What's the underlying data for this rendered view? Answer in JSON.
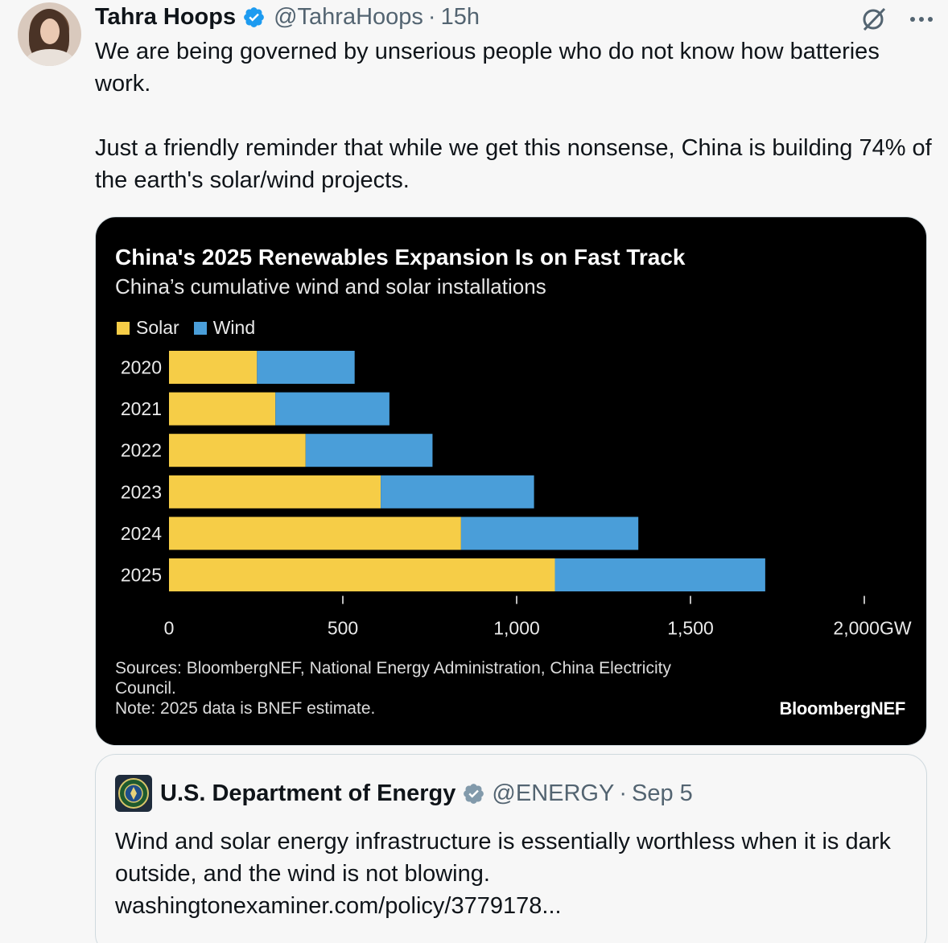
{
  "tweet": {
    "author_name": "Tahra Hoops",
    "handle": "@TahraHoops",
    "time": "15h",
    "separator": "·",
    "text_line1": "We are being governed by unserious people who do not know how batteries work.",
    "text_line2": "Just a friendly reminder that while we get this nonsense, China is building 74% of the earth's solar/wind projects."
  },
  "icons": {
    "verified": "verified-badge-icon",
    "grok": "grok-icon",
    "more": "more-icon"
  },
  "chart_data": {
    "type": "bar",
    "orientation": "horizontal",
    "stacked": true,
    "title": "China's 2025 Renewables Expansion Is on Fast Track",
    "subtitle": "China’s cumulative wind and solar installations",
    "categories": [
      "2020",
      "2021",
      "2022",
      "2023",
      "2024",
      "2025"
    ],
    "series": [
      {
        "name": "Solar",
        "color": "#f6cd47",
        "values": [
          253,
          306,
          393,
          609,
          840,
          1110
        ]
      },
      {
        "name": "Wind",
        "color": "#4a9ed9",
        "values": [
          281,
          328,
          365,
          441,
          510,
          605
        ]
      }
    ],
    "xlim": [
      0,
      2000
    ],
    "x_ticks": [
      "0",
      "500",
      "1,000",
      "1,500",
      "2,000GW"
    ],
    "x_tick_values": [
      0,
      500,
      1000,
      1500,
      2000
    ],
    "legend_position": "top-left",
    "grid": false,
    "sources": "Sources: BloombergNEF, National Energy Administration, China Electricity Council.",
    "note": "Note: 2025 data is BNEF estimate.",
    "brand": "BloombergNEF"
  },
  "quote": {
    "author_name": "U.S. Department of Energy",
    "handle": "@ENERGY",
    "separator": "·",
    "date": "Sep 5",
    "text": "Wind and solar energy infrastructure is essentially worthless when it is dark outside, and the wind is not blowing.",
    "link": "washingtonexaminer.com/policy/3779178..."
  }
}
